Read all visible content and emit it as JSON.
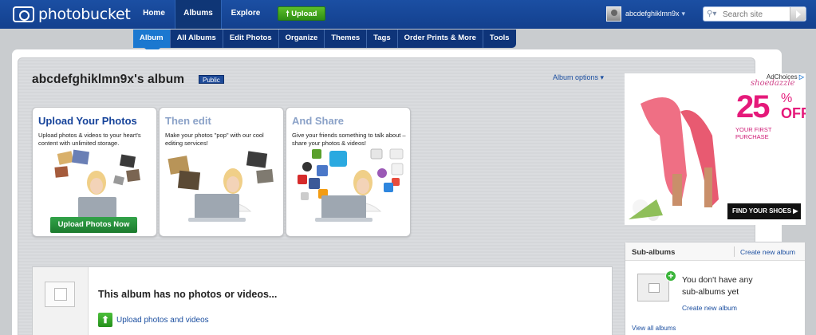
{
  "header": {
    "logo_text": "photobucket",
    "nav": {
      "home": "Home",
      "albums": "Albums",
      "explore": "Explore"
    },
    "upload_label": "Upload",
    "username": "abcdefghiklmn9x",
    "user_caret": "▾",
    "search_placeholder": "Search site"
  },
  "subnav": [
    "Album",
    "All Albums",
    "Edit Photos",
    "Organize",
    "Themes",
    "Tags",
    "Order Prints & More",
    "Tools"
  ],
  "album": {
    "title": "abcdefghiklmn9x's album",
    "visibility": "Public",
    "options_label": "Album options ▾"
  },
  "cards": [
    {
      "title": "Upload Your Photos",
      "desc": "Upload photos & videos to your heart's content with unlimited storage.",
      "button": "Upload Photos Now"
    },
    {
      "title": "Then edit",
      "desc": "Make your photos \"pop\" with our cool editing services!"
    },
    {
      "title": "And Share",
      "desc": "Give your friends something to talk about – share your photos & videos!"
    }
  ],
  "ad": {
    "adchoices": "AdChoices",
    "brand": "shoedazzle",
    "percent": "25",
    "pct_sign": "%",
    "off": "OFF",
    "sub": "YOUR FIRST PURCHASE",
    "cta": "FIND YOUR SHOES ▶"
  },
  "sub_albums": {
    "title": "Sub-albums",
    "create_link": "Create new album",
    "message": "You don't have any sub-albums yet",
    "create_link2": "Create new album",
    "view_all": "View all albums"
  },
  "empty": {
    "title": "This album has no photos or videos...",
    "upload_link": "Upload photos and videos"
  },
  "colors": {
    "brand_blue": "#1b4fa3",
    "upload_green": "#2f8e14",
    "link_blue": "#1c4fa0",
    "ad_pink": "#e5197a"
  }
}
